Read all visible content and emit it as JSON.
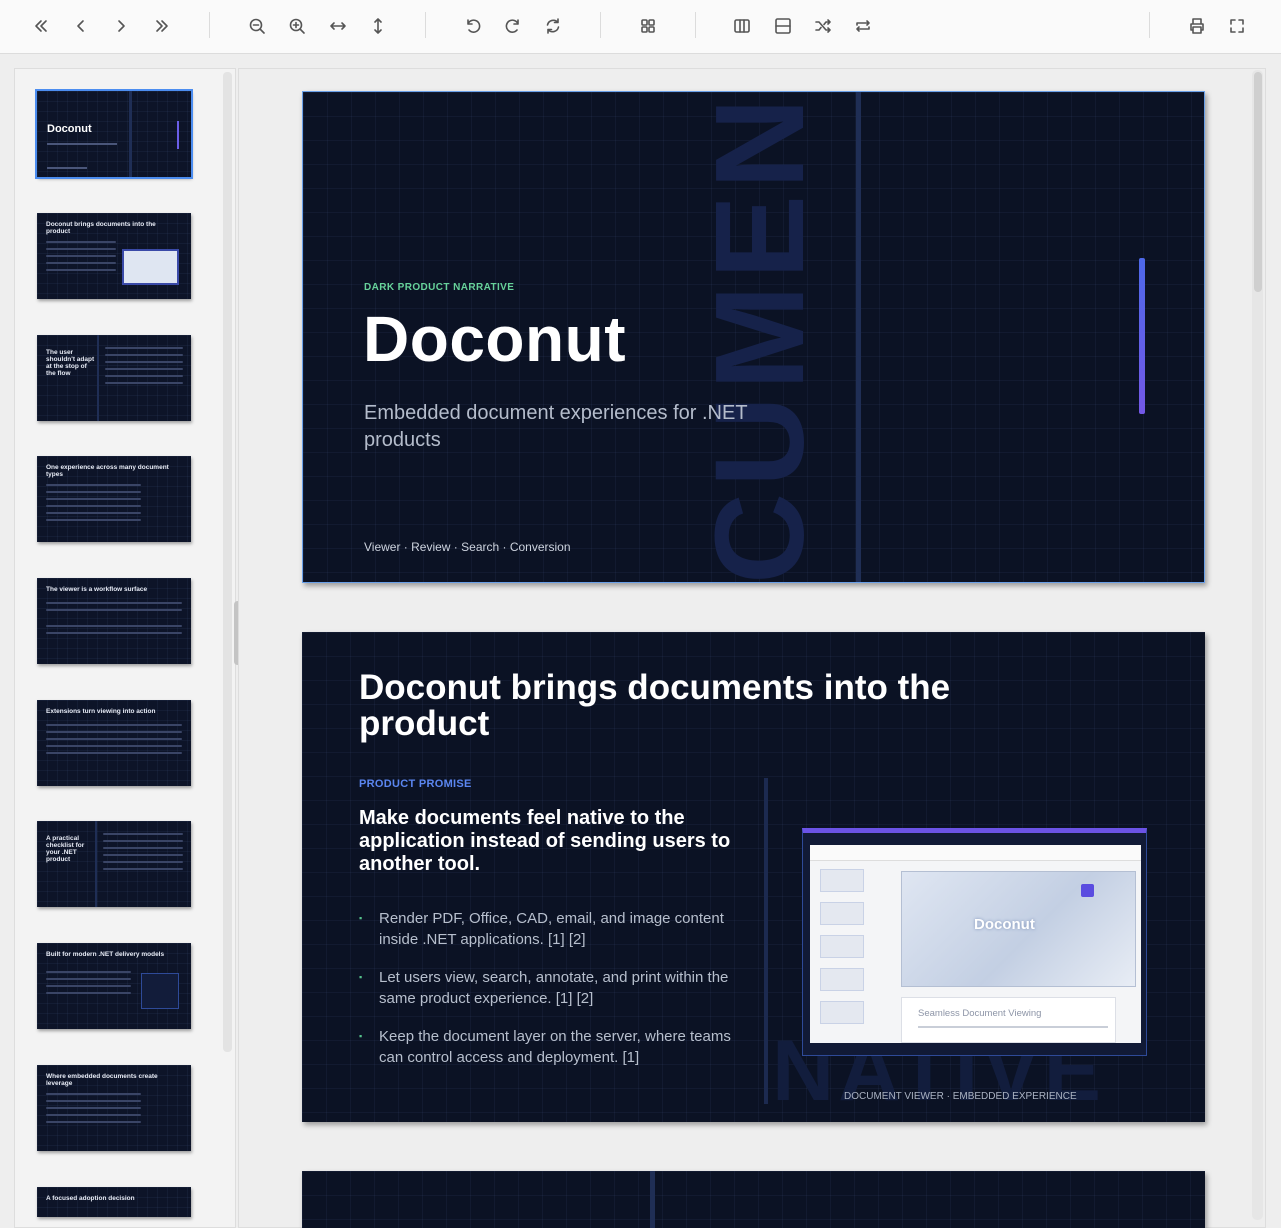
{
  "toolbar": {
    "buttons": [
      {
        "name": "first-page-icon",
        "label": "First page"
      },
      {
        "name": "previous-page-icon",
        "label": "Previous page"
      },
      {
        "name": "next-page-icon",
        "label": "Next page"
      },
      {
        "name": "last-page-icon",
        "label": "Last page"
      },
      {
        "name": "zoom-out-icon",
        "label": "Zoom out"
      },
      {
        "name": "zoom-in-icon",
        "label": "Zoom in"
      },
      {
        "name": "fit-width-icon",
        "label": "Fit width"
      },
      {
        "name": "fit-height-icon",
        "label": "Fit height"
      },
      {
        "name": "rotate-left-icon",
        "label": "Rotate left"
      },
      {
        "name": "rotate-right-icon",
        "label": "Rotate right"
      },
      {
        "name": "reset-rotation-icon",
        "label": "Reset"
      },
      {
        "name": "grid-view-icon",
        "label": "Grid view"
      },
      {
        "name": "two-page-icon",
        "label": "Two page"
      },
      {
        "name": "continuous-scroll-icon",
        "label": "Scroll"
      },
      {
        "name": "shuffle-icon",
        "label": "Shuffle"
      },
      {
        "name": "repeat-icon",
        "label": "Repeat"
      },
      {
        "name": "print-icon",
        "label": "Print"
      },
      {
        "name": "fullscreen-icon",
        "label": "Fullscreen"
      }
    ]
  },
  "thumbnails": [
    {
      "title": "Doconut",
      "active": true
    },
    {
      "title": "Doconut brings documents into the product"
    },
    {
      "title": "The user shouldn't adapt at the stop of the flow"
    },
    {
      "title": "One experience across many document types"
    },
    {
      "title": "The viewer is a workflow surface"
    },
    {
      "title": "Extensions turn viewing into action"
    },
    {
      "title": "A practical checklist for your .NET product"
    },
    {
      "title": "Built for modern .NET delivery models"
    },
    {
      "title": "Where embedded documents create leverage"
    },
    {
      "title": "A focused adoption decision"
    }
  ],
  "slide1": {
    "eyebrow": "DARK PRODUCT NARRATIVE",
    "title": "Doconut",
    "subtitle": "Embedded document experiences for .NET products",
    "footer": "Viewer · Review · Search · Conversion",
    "watermark": "CUMENT"
  },
  "slide2": {
    "title": "Doconut brings documents into the product",
    "eyebrow": "PRODUCT PROMISE",
    "lead": "Make documents feel native to the application instead of sending users to another tool.",
    "bullets": [
      "Render PDF, Office, CAD, email, and image content inside .NET applications. [1] [2]",
      "Let users view, search, annotate, and print within the same product experience. [1] [2]",
      "Keep the document layer on the server, where teams can control access and deployment. [1]"
    ],
    "screenshot": {
      "logo": "Doconut",
      "card_title": "Seamless Document Viewing"
    },
    "caption": "DOCUMENT VIEWER · EMBEDDED EXPERIENCE",
    "watermark": "NATIVE"
  }
}
